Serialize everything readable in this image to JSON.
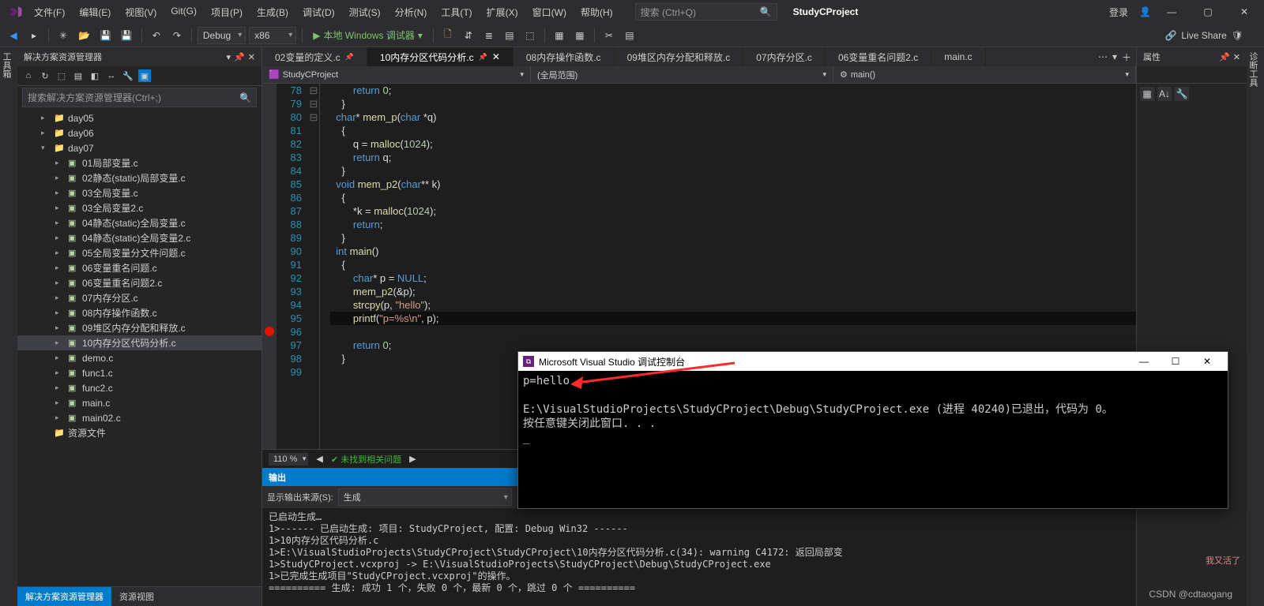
{
  "title": {
    "project": "StudyCProject",
    "login": "登录"
  },
  "menu": [
    "文件(F)",
    "编辑(E)",
    "视图(V)",
    "Git(G)",
    "项目(P)",
    "生成(B)",
    "调试(D)",
    "测试(S)",
    "分析(N)",
    "工具(T)",
    "扩展(X)",
    "窗口(W)",
    "帮助(H)"
  ],
  "search_placeholder": "搜索 (Ctrl+Q)",
  "toolbar": {
    "config": "Debug",
    "platform": "x86",
    "run": "本地 Windows 调试器",
    "liveshare": "Live Share"
  },
  "sidestrip_left": "工具箱",
  "sidestrip_right": "诊断工具",
  "sln": {
    "title": "解决方案资源管理器",
    "search": "搜索解决方案资源管理器(Ctrl+;)",
    "nodes": [
      {
        "lvl": 1,
        "arr": "▸",
        "ico": "📁",
        "lbl": "day05",
        "cls": "folder"
      },
      {
        "lvl": 1,
        "arr": "▸",
        "ico": "📁",
        "lbl": "day06",
        "cls": "folder"
      },
      {
        "lvl": 1,
        "arr": "▾",
        "ico": "📁",
        "lbl": "day07",
        "cls": "folder"
      },
      {
        "lvl": 2,
        "arr": "▸",
        "ico": "c",
        "lbl": "01局部变量.c",
        "cls": "cfile"
      },
      {
        "lvl": 2,
        "arr": "▸",
        "ico": "c",
        "lbl": "02静态(static)局部变量.c",
        "cls": "cfile"
      },
      {
        "lvl": 2,
        "arr": "▸",
        "ico": "c",
        "lbl": "03全局变量.c",
        "cls": "cfile"
      },
      {
        "lvl": 2,
        "arr": "▸",
        "ico": "c",
        "lbl": "03全局变量2.c",
        "cls": "cfile"
      },
      {
        "lvl": 2,
        "arr": "▸",
        "ico": "c",
        "lbl": "04静态(static)全局变量.c",
        "cls": "cfile"
      },
      {
        "lvl": 2,
        "arr": "▸",
        "ico": "c",
        "lbl": "04静态(static)全局变量2.c",
        "cls": "cfile"
      },
      {
        "lvl": 2,
        "arr": "▸",
        "ico": "c",
        "lbl": "05全局变量分文件问题.c",
        "cls": "cfile"
      },
      {
        "lvl": 2,
        "arr": "▸",
        "ico": "c",
        "lbl": "06变量重名问题.c",
        "cls": "cfile"
      },
      {
        "lvl": 2,
        "arr": "▸",
        "ico": "c",
        "lbl": "06变量重名问题2.c",
        "cls": "cfile"
      },
      {
        "lvl": 2,
        "arr": "▸",
        "ico": "c",
        "lbl": "07内存分区.c",
        "cls": "cfile"
      },
      {
        "lvl": 2,
        "arr": "▸",
        "ico": "c",
        "lbl": "08内存操作函数.c",
        "cls": "cfile"
      },
      {
        "lvl": 2,
        "arr": "▸",
        "ico": "c",
        "lbl": "09堆区内存分配和释放.c",
        "cls": "cfile"
      },
      {
        "lvl": 2,
        "arr": "▸",
        "ico": "c",
        "lbl": "10内存分区代码分析.c",
        "cls": "cfile",
        "sel": true
      },
      {
        "lvl": 2,
        "arr": "▸",
        "ico": "c",
        "lbl": "demo.c",
        "cls": "cfile"
      },
      {
        "lvl": 2,
        "arr": "▸",
        "ico": "c",
        "lbl": "func1.c",
        "cls": "cfile"
      },
      {
        "lvl": 2,
        "arr": "▸",
        "ico": "c",
        "lbl": "func2.c",
        "cls": "cfile"
      },
      {
        "lvl": 2,
        "arr": "▸",
        "ico": "c",
        "lbl": "main.c",
        "cls": "cfile"
      },
      {
        "lvl": 2,
        "arr": "▸",
        "ico": "c",
        "lbl": "main02.c",
        "cls": "cfile"
      },
      {
        "lvl": 1,
        "arr": "",
        "ico": "📁",
        "lbl": "资源文件",
        "cls": "folder"
      }
    ],
    "tabs": [
      "解决方案资源管理器",
      "资源视图"
    ]
  },
  "tabs": [
    {
      "lbl": "02变量的定义.c",
      "pin": true
    },
    {
      "lbl": "10内存分区代码分析.c",
      "active": true,
      "pin": true
    },
    {
      "lbl": "08内存操作函数.c"
    },
    {
      "lbl": "09堆区内存分配和释放.c"
    },
    {
      "lbl": "07内存分区.c"
    },
    {
      "lbl": "06变量重名问题2.c"
    },
    {
      "lbl": "main.c"
    }
  ],
  "nav": {
    "scope": "StudyCProject",
    "region": "(全局范围)",
    "func": "main()"
  },
  "code": {
    "start": 78,
    "lines": [
      {
        "n": 78,
        "t": "        return 0;"
      },
      {
        "n": 79,
        "t": "    }"
      },
      {
        "n": 80,
        "t": ""
      },
      {
        "n": 81,
        "t": "  ⊟char* mem_p(char *q)",
        "open": true
      },
      {
        "n": 82,
        "t": "    {"
      },
      {
        "n": 83,
        "t": "        q = malloc(1024);"
      },
      {
        "n": 84,
        "t": "        return q;"
      },
      {
        "n": 85,
        "t": "    }"
      },
      {
        "n": 86,
        "t": "  ⊟void mem_p2(char** k)",
        "open": true
      },
      {
        "n": 87,
        "t": "    {"
      },
      {
        "n": 88,
        "t": "        *k = malloc(1024);"
      },
      {
        "n": 89,
        "t": "        return;"
      },
      {
        "n": 90,
        "t": "    }"
      },
      {
        "n": 91,
        "t": "  ⊟int main()",
        "open": true
      },
      {
        "n": 92,
        "t": "    {"
      },
      {
        "n": 93,
        "t": "        char* p = NULL;"
      },
      {
        "n": 94,
        "t": "        mem_p2(&p);"
      },
      {
        "n": 95,
        "t": "        strcpy(p, \"hello\");"
      },
      {
        "n": 96,
        "t": "        printf(\"p=%s\\n\", p);",
        "bp": true,
        "cur": true
      },
      {
        "n": 97,
        "t": "    "
      },
      {
        "n": 98,
        "t": "        return 0;"
      },
      {
        "n": 99,
        "t": "    }"
      }
    ]
  },
  "edstatus": {
    "zoom": "110 %",
    "issues": "未找到相关问题"
  },
  "output": {
    "title": "输出",
    "source_label": "显示输出来源(S):",
    "source": "生成",
    "text": "已启动生成…\n1>------ 已启动生成: 项目: StudyCProject, 配置: Debug Win32 ------\n1>10内存分区代码分析.c\n1>E:\\VisualStudioProjects\\StudyCProject\\StudyCProject\\10内存分区代码分析.c(34): warning C4172: 返回局部变\n1>StudyCProject.vcxproj -> E:\\VisualStudioProjects\\StudyCProject\\Debug\\StudyCProject.exe\n1>已完成生成项目\"StudyCProject.vcxproj\"的操作。\n========== 生成: 成功 1 个，失败 0 个，最新 0 个，跳过 0 个 =========="
  },
  "props": {
    "title": "属性"
  },
  "console": {
    "title": "Microsoft Visual Studio 调试控制台",
    "body": "p=hello\n\nE:\\VisualStudioProjects\\StudyCProject\\Debug\\StudyCProject.exe (进程 40240)已退出，代码为 0。\n按任意键关闭此窗口. . .\n_"
  },
  "mascot": "我又活了",
  "watermark": "CSDN @cdtaogang"
}
